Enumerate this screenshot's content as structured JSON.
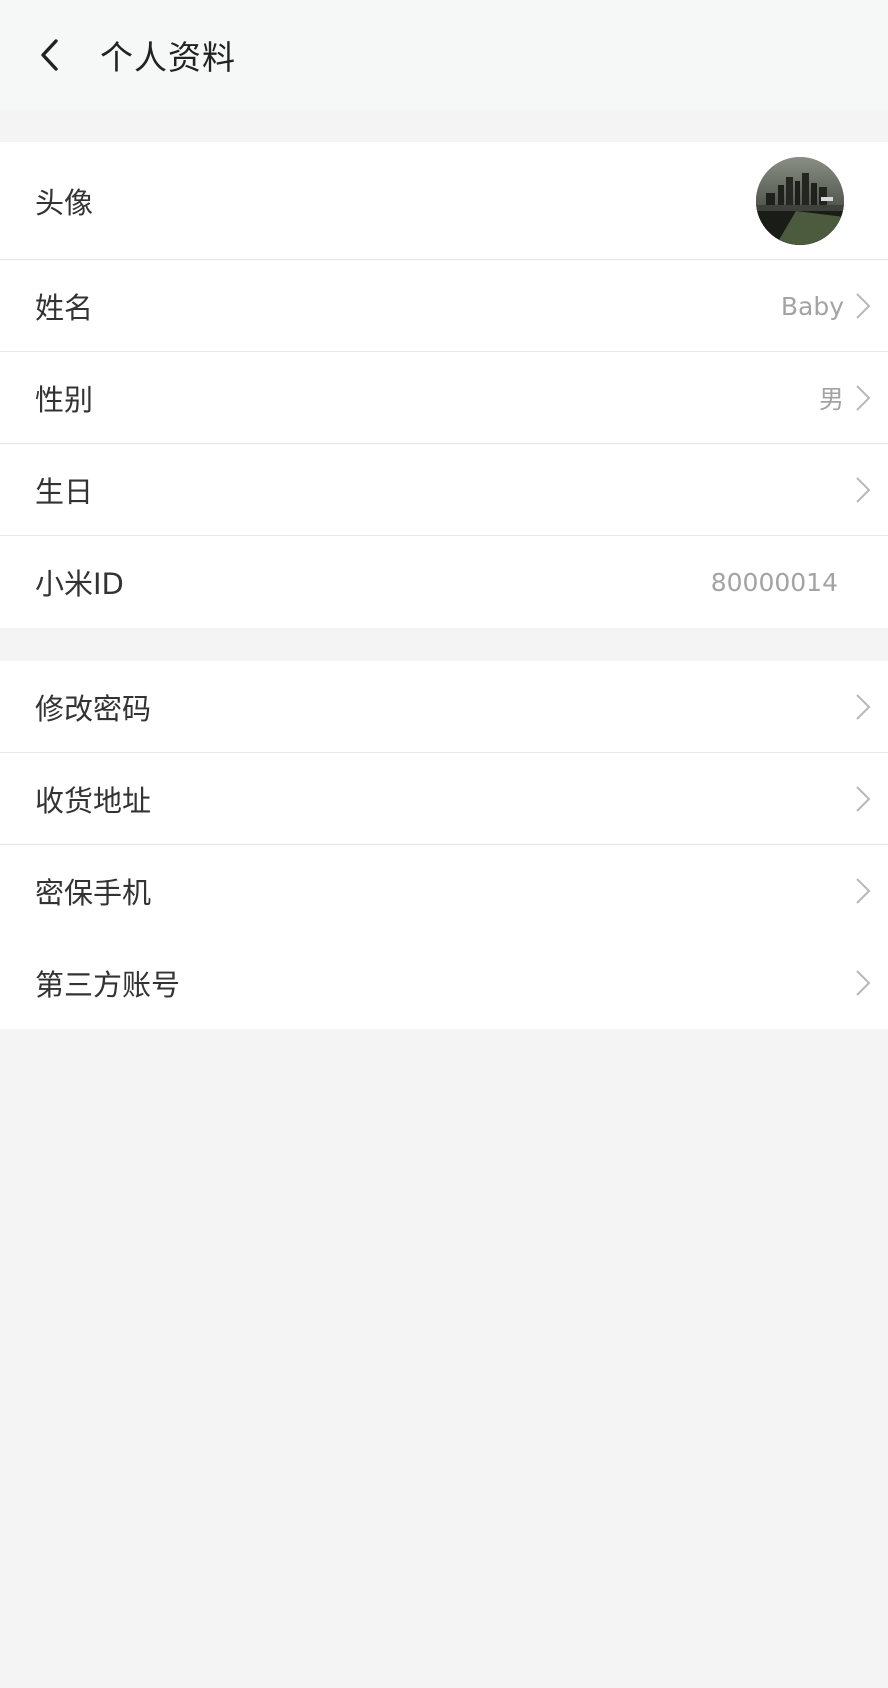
{
  "header": {
    "title": "个人资料",
    "back_icon": "chevron-left-icon"
  },
  "profile": {
    "avatar_label": "头像",
    "name_label": "姓名",
    "name_value": "Baby",
    "gender_label": "性别",
    "gender_value": "男",
    "birthday_label": "生日",
    "birthday_value": "",
    "mi_id_label": "小米ID",
    "mi_id_value": "80000014"
  },
  "security": {
    "change_password_label": "修改密码",
    "address_label": "收货地址",
    "security_phone_label": "密保手机",
    "third_party_label": "第三方账号"
  },
  "colors": {
    "page_bg": "#f4f4f4",
    "header_bg": "#f6f7f7",
    "row_bg": "#ffffff",
    "divider": "#e6e6e6",
    "label_text": "#333333",
    "value_text": "#a3a3a3",
    "chevron": "#b8b8b8"
  }
}
